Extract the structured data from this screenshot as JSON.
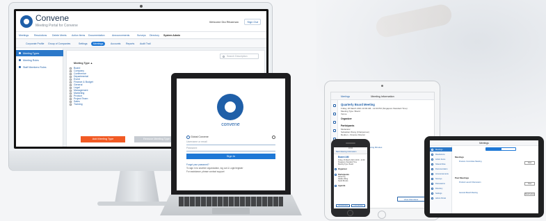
{
  "desktop": {
    "brand": "Convene",
    "brand_sub": "Meeting Portal for Convene",
    "welcome": "Welcome Dia Ribarman",
    "signout": "Sign Out",
    "topnav": [
      "Meetings",
      "Resolutions",
      "Delete Meets",
      "Action Items",
      "Documentation",
      "Announcements",
      "Surveys",
      "Directory",
      "System Admin"
    ],
    "subnav": [
      "Corporate Profile",
      "Group of Companies",
      "Settings",
      "Meetings",
      "Accounts",
      "Reports",
      "Audit Trail"
    ],
    "subnav_active": "Meetings",
    "sidebar": [
      "Meeting Types",
      "Meeting Roles",
      "Staff Members Roles"
    ],
    "search_placeholder": "Search Description",
    "table_header": "Meeting Type ▲",
    "meeting_types": [
      "Board",
      "Company",
      "Conference",
      "Departmental",
      "Event",
      "Finance & Budget",
      "General",
      "Legal",
      "Management",
      "Marketing",
      "Product",
      "Project Team",
      "Sales",
      "Training"
    ],
    "add_button": "Add Meeting Type",
    "remove_button": "Remove Meeting Type"
  },
  "laptop": {
    "brand": "convene",
    "radio_label": "Global Convene",
    "username_placeholder": "Username or email",
    "password_placeholder": "Password",
    "signin": "Sign In",
    "forgot": "Forgot your password?",
    "signup": "To sign in to another organization, log out & Login/register",
    "assistance": "For assistance, please contact support"
  },
  "ipad": {
    "title": "Meeting Information",
    "back": "Meetings",
    "meeting_title": "Quarterly Board Meeting",
    "lines": [
      "Friday, 26 March 2021 10:00 AM - 12:00 PM (Singapore Standard Time)",
      "Meeting Type: Board",
      "Venue"
    ],
    "sections": [
      "Organizer",
      "Participants",
      "Agenda",
      "Private Notes"
    ],
    "participants": [
      "Moderator",
      "Sebastian Wong (Chairperson)",
      "Reuben - Finance Director"
    ],
    "agenda": [
      "Review Previous Minutes",
      "Approval of Previous Board Meeting Minutes",
      "Confirmation/Adjournment",
      "Ratification of Minutes"
    ],
    "button": "View Attendees"
  },
  "phone": {
    "status": "10:04",
    "back": "Back  Meeting Information",
    "title": "Board AM",
    "lines": [
      "Friday, 26 March 2021 10:00 - 12:00",
      "Singapore Standard Time",
      "Meeting Type: Board"
    ],
    "sections": [
      "Organizer",
      "Participants",
      "Agenda"
    ],
    "participants": [
      "Daniel Ng",
      "Natalie Wang",
      "Sarah Brooks"
    ],
    "buttons": [
      "View Attendees",
      "Post Meeting"
    ]
  },
  "tablet_landscape": {
    "title": "Meetings",
    "sidebar": [
      "Meetings",
      "Resolutions",
      "Action Items",
      "Shared Files",
      "Documentation",
      "Announcements",
      "Surveys",
      "Discussions",
      "Directory",
      "Settings",
      "Admin Portal"
    ],
    "sections": [
      "Meetings",
      "Past Meetings"
    ],
    "items": [
      "Finance Committee Meeting",
      "Product Launch Discussion",
      "General Board Meeting"
    ],
    "buttons": [
      "View",
      "View",
      "Reschedule"
    ]
  }
}
